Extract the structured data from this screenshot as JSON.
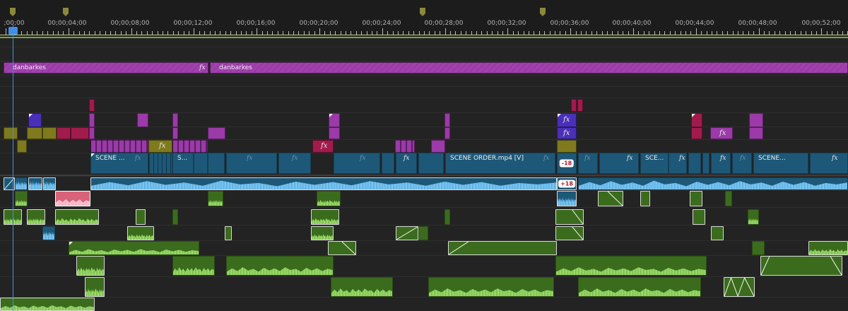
{
  "ruler": {
    "labels": [
      ";00;00",
      "00;00;04;00",
      "00;00;08;00",
      "00;00;12;00",
      "00;00;16;00",
      "00;00;20;00",
      "00;00;24;00",
      "00;00;28;00",
      "00;00;32;00",
      "00;00;36;00",
      "00;00;40;00",
      "00;00;44;00",
      "00;00;48;00",
      "00;00;52;00"
    ],
    "marker_color": "#8a8a3a"
  },
  "playhead": {
    "color": "#3f8fe8"
  },
  "tracks": {
    "adjustment": {
      "label_1": "danbarkes",
      "label_2": "danbarkes",
      "fx": "fx"
    },
    "video": {
      "label_1": "SCENE ...",
      "label_2": "S...",
      "label_3": "SCENE ORDER.mp4 [V]",
      "label_4": "SCE...",
      "label_5": "SCENE...",
      "fx": "fx",
      "offset_badge": "-18"
    },
    "audio": {
      "offset_badge": "+18"
    }
  },
  "colors": {
    "adjustment": "#9b3aa8",
    "title_indigo": "#4a2fb8",
    "title_crimson": "#a21b4d",
    "title_olive": "#7e7a1d",
    "video": "#1d5878",
    "audio_wave": "#7dc7f0",
    "music": "#3b6c1d",
    "selected_audio": "#d8627a"
  }
}
